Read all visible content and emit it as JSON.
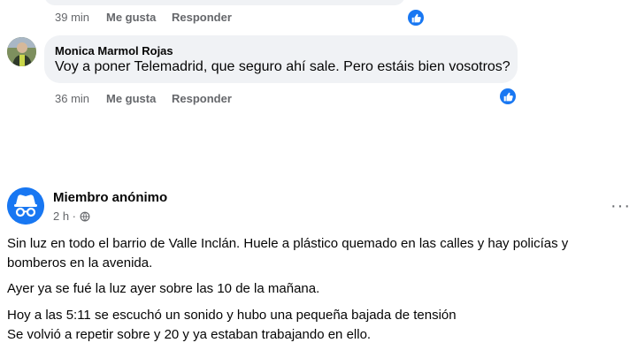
{
  "comment_first": {
    "time": "39 min",
    "like_label": "Me gusta",
    "reply_label": "Responder"
  },
  "comment_second": {
    "author": "Monica Marmol Rojas",
    "text": "Voy a poner Telemadrid, que seguro ahí sale. Pero estáis bien vosotros?",
    "time": "36 min",
    "like_label": "Me gusta",
    "reply_label": "Responder"
  },
  "post": {
    "author": "Miembro anónimo",
    "time": "2 h ·",
    "more_label": "···",
    "paragraphs": [
      [
        "Sin luz en todo el barrio de Valle Inclán. Huele a plástico quemado en las calles y hay policías y",
        "bomberos en la avenida."
      ],
      [
        "Ayer ya se fué la luz ayer sobre las 10 de la mañana."
      ],
      [
        "Hoy a las 5:11 se escuchó un sonido y hubo una pequeña bajada de tensión",
        "Se volvió a repetir sobre y 20 y ya estaban trabajando en ello."
      ]
    ]
  },
  "icons": {
    "like": "thumbs-up-icon",
    "privacy": "globe-icon",
    "anonymous": "incognito-icon"
  },
  "colors": {
    "accent": "#1877f2",
    "meta_text": "#65676b",
    "bubble": "#f0f2f5"
  }
}
